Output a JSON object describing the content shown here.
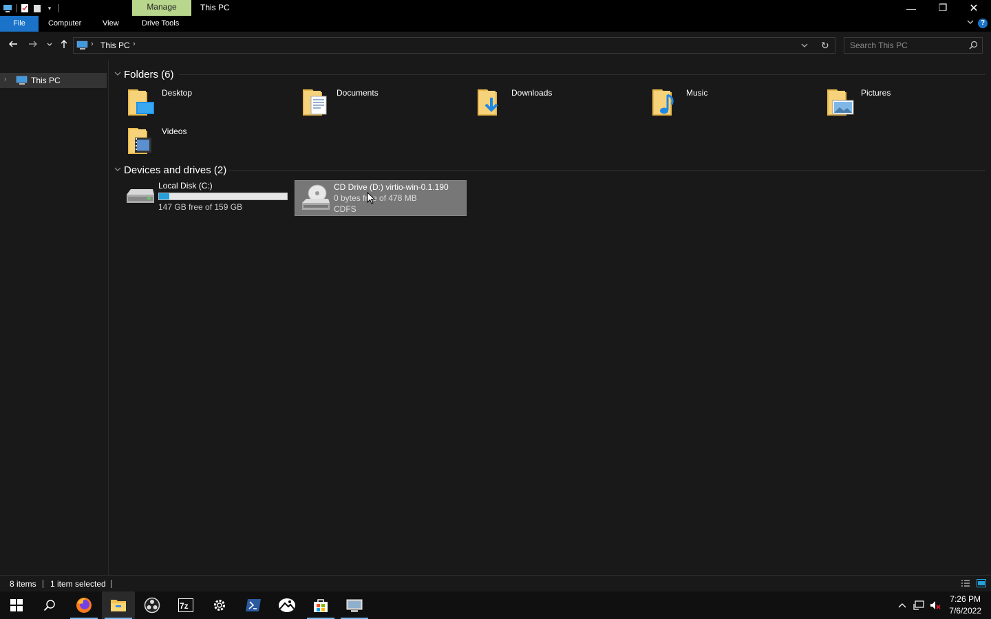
{
  "window": {
    "title": "This PC",
    "contextual_tab": "Manage",
    "controls": {
      "minimize": "—",
      "restore": "❐",
      "close": "✕"
    }
  },
  "ribbon": {
    "tabs": [
      "File",
      "Computer",
      "View",
      "Drive Tools"
    ],
    "help": "?"
  },
  "address": {
    "crumbs": [
      "This PC"
    ],
    "search_placeholder": "Search This PC"
  },
  "nav_pane": {
    "items": [
      {
        "label": "This PC",
        "icon": "computer-icon",
        "selected": true
      }
    ]
  },
  "groups": {
    "folders": {
      "title": "Folders (6)",
      "items": [
        {
          "name": "Desktop",
          "icon": "desktop-folder-icon"
        },
        {
          "name": "Documents",
          "icon": "documents-folder-icon"
        },
        {
          "name": "Downloads",
          "icon": "downloads-folder-icon"
        },
        {
          "name": "Music",
          "icon": "music-folder-icon"
        },
        {
          "name": "Pictures",
          "icon": "pictures-folder-icon"
        },
        {
          "name": "Videos",
          "icon": "videos-folder-icon"
        }
      ]
    },
    "drives": {
      "title": "Devices and drives (2)",
      "items": [
        {
          "name": "Local Disk (C:)",
          "info": "147 GB free of 159 GB",
          "used_fraction": 0.08,
          "icon": "hard-disk-icon"
        },
        {
          "name": "CD Drive (D:) virtio-win-0.1.190",
          "info": "0 bytes free of 478 MB",
          "fs": "CDFS",
          "icon": "cd-drive-icon",
          "selected": true
        }
      ]
    }
  },
  "status": {
    "items_count": "8 items",
    "selection": "1 item selected"
  },
  "taskbar": {
    "apps": [
      "start-icon",
      "search-icon",
      "firefox-icon",
      "file-explorer-icon",
      "obs-icon",
      "7zip-icon",
      "settings-icon",
      "powershell-icon",
      "photos-icon",
      "store-icon",
      "network-app-icon"
    ],
    "time": "7:26 PM",
    "date": "7/6/2022"
  },
  "colors": {
    "accent": "#1a73c8",
    "manage_tab": "#b8d78c",
    "background": "#191919",
    "selection": "#777777",
    "disk_bar": "#26a0da"
  }
}
